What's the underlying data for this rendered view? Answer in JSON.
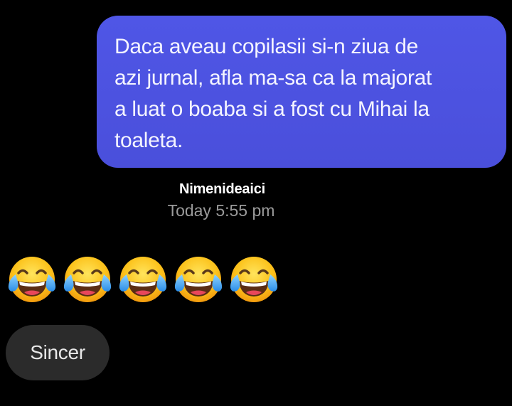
{
  "conversation": {
    "sent_message": {
      "lines": [
        "Daca aveau copilasii si-n ziua de",
        "azi jurnal, afla ma-sa ca la majorat",
        "a luat o boaba si a fost cu Mihai la",
        "toaleta."
      ]
    },
    "sender_name": "Nimenideaici",
    "timestamp": "Today 5:55 pm",
    "emoji_reaction": {
      "icon": "face-with-tears-of-joy-icon",
      "count": 5
    },
    "received_message": "Sincer"
  },
  "colors": {
    "background": "#000000",
    "sent_bubble": "#4c52e0",
    "received_bubble": "#2b2b2b",
    "timestamp": "#9b9b9b"
  }
}
